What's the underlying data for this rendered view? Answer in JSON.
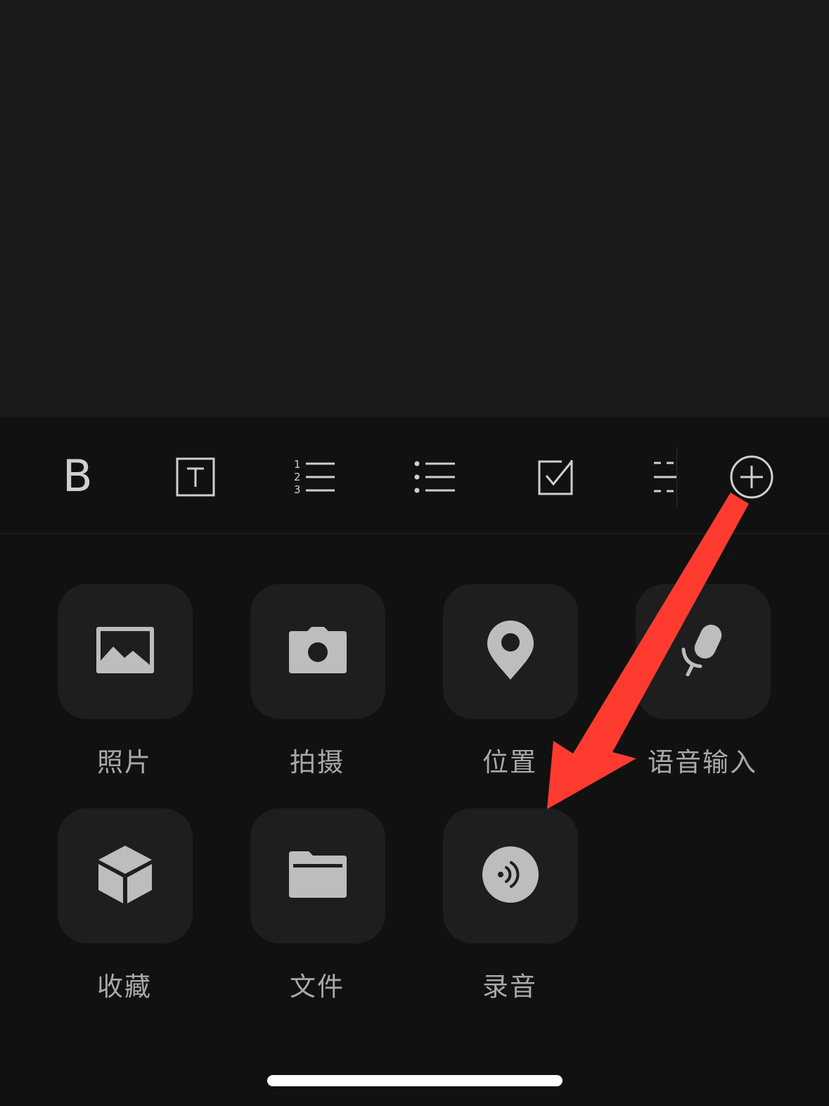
{
  "toolbar": {
    "bold_label": "B",
    "items": [
      {
        "icon": "bold-icon"
      },
      {
        "icon": "text-style-icon"
      },
      {
        "icon": "numbered-list-icon"
      },
      {
        "icon": "bulleted-list-icon"
      },
      {
        "icon": "checkbox-icon"
      },
      {
        "icon": "divider-line-icon"
      },
      {
        "icon": "plus-circle-icon"
      }
    ]
  },
  "attachments": {
    "row1": [
      {
        "label": "照片",
        "icon": "photo-icon"
      },
      {
        "label": "拍摄",
        "icon": "camera-icon"
      },
      {
        "label": "位置",
        "icon": "location-pin-icon"
      },
      {
        "label": "语音输入",
        "icon": "microphone-icon"
      }
    ],
    "row2": [
      {
        "label": "收藏",
        "icon": "cube-icon"
      },
      {
        "label": "文件",
        "icon": "folder-icon"
      },
      {
        "label": "录音",
        "icon": "audio-record-icon"
      }
    ]
  },
  "colors": {
    "background": "#111111",
    "editor_background": "#1a1a1a",
    "tile_background": "#1e1e1e",
    "icon_color": "#bdbdbd",
    "label_color": "#a9a9a9",
    "annotation_arrow": "#ff3b30"
  }
}
